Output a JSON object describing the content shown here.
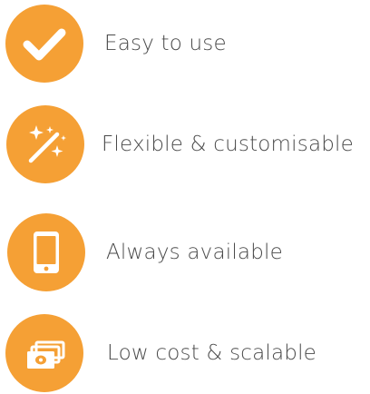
{
  "colors": {
    "accent": "#F5A035",
    "icon": "#ffffff",
    "text": "#4a4a4a"
  },
  "features": [
    {
      "label": "Easy to use",
      "icon": "checkmark-icon"
    },
    {
      "label": "Flexible & customisable",
      "icon": "magic-wand-icon"
    },
    {
      "label": "Always available",
      "icon": "smartphone-icon"
    },
    {
      "label": "Low cost & scalable",
      "icon": "money-stack-icon"
    }
  ]
}
